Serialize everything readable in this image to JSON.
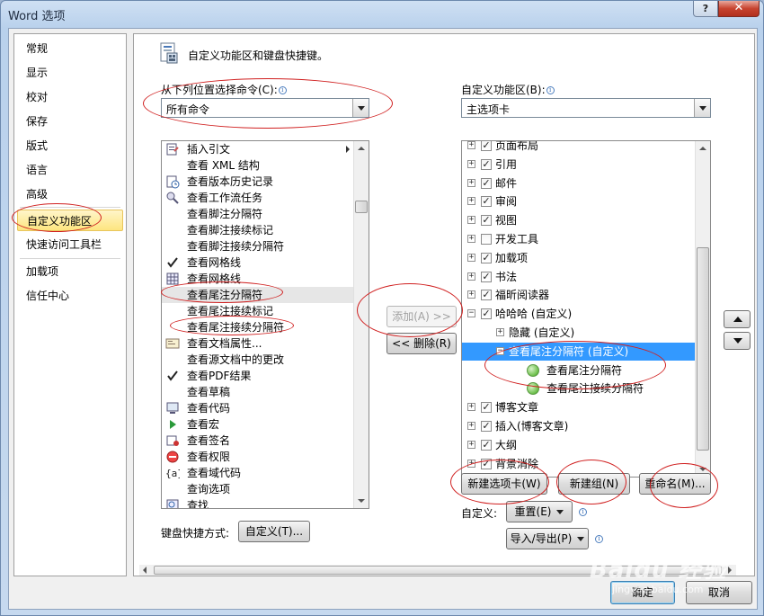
{
  "window": {
    "title": "Word 选项",
    "help": "?",
    "close": "✕"
  },
  "nav": {
    "items": [
      "常规",
      "显示",
      "校对",
      "保存",
      "版式",
      "语言",
      "高级",
      "自定义功能区",
      "快速访问工具栏",
      "加载项",
      "信任中心"
    ],
    "selected": "自定义功能区"
  },
  "header": {
    "title": "自定义功能区和键盘快捷键。"
  },
  "left": {
    "label": "从下列位置选择命令(C):",
    "combo_value": "所有命令",
    "commands": [
      {
        "label": "插入引文",
        "icon": "citation-icon",
        "submenu": true
      },
      {
        "label": "查看 XML 结构",
        "icon": ""
      },
      {
        "label": "查看版本历史记录",
        "icon": "version-history-icon"
      },
      {
        "label": "查看工作流任务",
        "icon": "workflow-icon"
      },
      {
        "label": "查看脚注分隔符",
        "icon": ""
      },
      {
        "label": "查看脚注接续标记",
        "icon": ""
      },
      {
        "label": "查看脚注接续分隔符",
        "icon": ""
      },
      {
        "label": "查看网格线",
        "icon": "checkmark-icon"
      },
      {
        "label": "查看网格线",
        "icon": "grid-icon"
      },
      {
        "label": "查看尾注分隔符",
        "icon": ""
      },
      {
        "label": "查看尾注接续标记",
        "icon": ""
      },
      {
        "label": "查看尾注接续分隔符",
        "icon": ""
      },
      {
        "label": "查看文档属性...",
        "icon": "document-properties-icon"
      },
      {
        "label": "查看源文档中的更改",
        "icon": ""
      },
      {
        "label": "查看PDF结果",
        "icon": "checkmark-icon"
      },
      {
        "label": "查看草稿",
        "icon": ""
      },
      {
        "label": "查看代码",
        "icon": "code-icon"
      },
      {
        "label": "查看宏",
        "icon": "macro-play-icon"
      },
      {
        "label": "查看签名",
        "icon": "signature-icon"
      },
      {
        "label": "查看权限",
        "icon": "permission-icon"
      },
      {
        "label": "查看域代码",
        "icon": "field-code-icon"
      },
      {
        "label": "查询选项",
        "icon": ""
      },
      {
        "label": "查找",
        "icon": "find-icon"
      }
    ],
    "selected_command": "查看尾注分隔符",
    "keyboard_label": "键盘快捷方式:",
    "customize_button": "自定义(T)..."
  },
  "middle": {
    "add_button": "添加(A) >>",
    "remove_button": "<< 删除(R)"
  },
  "right": {
    "label": "自定义功能区(B):",
    "combo_value": "主选项卡",
    "tree": [
      {
        "label": "页面布局",
        "level": 0,
        "expander": "+",
        "checked": true
      },
      {
        "label": "引用",
        "level": 0,
        "expander": "+",
        "checked": true
      },
      {
        "label": "邮件",
        "level": 0,
        "expander": "+",
        "checked": true
      },
      {
        "label": "审阅",
        "level": 0,
        "expander": "+",
        "checked": true
      },
      {
        "label": "视图",
        "level": 0,
        "expander": "+",
        "checked": true
      },
      {
        "label": "开发工具",
        "level": 0,
        "expander": "+",
        "checked": false
      },
      {
        "label": "加载项",
        "level": 0,
        "expander": "+",
        "checked": true
      },
      {
        "label": "书法",
        "level": 0,
        "expander": "+",
        "checked": true
      },
      {
        "label": "福昕阅读器",
        "level": 0,
        "expander": "+",
        "checked": true
      },
      {
        "label": "哈哈哈 (自定义)",
        "level": 0,
        "expander": "−",
        "checked": true
      },
      {
        "label": "隐藏 (自定义)",
        "level": 1,
        "expander": "+"
      },
      {
        "label": "查看尾注分隔符 (自定义)",
        "level": 1,
        "expander": "−",
        "selected": true
      },
      {
        "label": "查看尾注分隔符",
        "level": 2,
        "group_icon": true
      },
      {
        "label": "查看尾注接续分隔符",
        "level": 2,
        "group_icon": true
      },
      {
        "label": "博客文章",
        "level": 0,
        "expander": "+",
        "checked": true
      },
      {
        "label": "插入(博客文章)",
        "level": 0,
        "expander": "+",
        "checked": true
      },
      {
        "label": "大纲",
        "level": 0,
        "expander": "+",
        "checked": true
      },
      {
        "label": "背景消除",
        "level": 0,
        "expander": "+",
        "checked": true
      }
    ],
    "new_tab_button": "新建选项卡(W)",
    "new_group_button": "新建组(N)",
    "rename_button": "重命名(M)...",
    "customizations_label": "自定义:",
    "reset_button": "重置(E)",
    "import_export_button": "导入/导出(P)"
  },
  "footer": {
    "ok_button": "确定",
    "cancel_button": "取消"
  },
  "watermark": {
    "logo": "Baidu 经验",
    "url": "jingyan.baidu.com"
  },
  "colors": {
    "selection": "#3399ff",
    "nav_selected": "#fde57f",
    "annotation": "#d02020"
  }
}
